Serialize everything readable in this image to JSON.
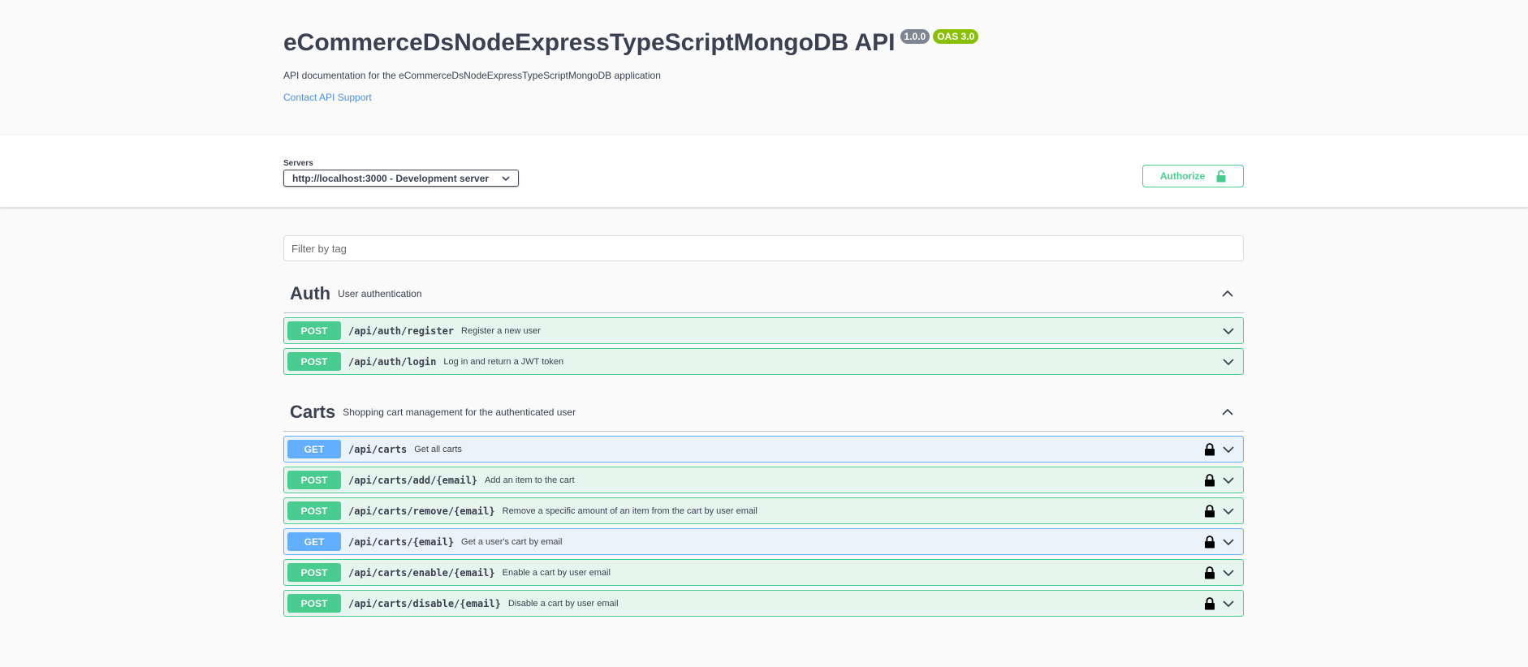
{
  "info": {
    "title": "eCommerceDsNodeExpressTypeScriptMongoDB API",
    "version": "1.0.0",
    "oas": "OAS 3.0",
    "description": "API documentation for the eCommerceDsNodeExpressTypeScriptMongoDB application",
    "contact": "Contact API Support"
  },
  "servers": {
    "label": "Servers",
    "selected": "http://localhost:3000 - Development server"
  },
  "authorize": {
    "label": "Authorize"
  },
  "filter": {
    "placeholder": "Filter by tag"
  },
  "tags": [
    {
      "name": "Auth",
      "description": "User authentication",
      "operations": [
        {
          "method": "POST",
          "path": "/api/auth/register",
          "summary": "Register a new user",
          "locked": false
        },
        {
          "method": "POST",
          "path": "/api/auth/login",
          "summary": "Log in and return a JWT token",
          "locked": false
        }
      ]
    },
    {
      "name": "Carts",
      "description": "Shopping cart management for the authenticated user",
      "operations": [
        {
          "method": "GET",
          "path": "/api/carts",
          "summary": "Get all carts",
          "locked": true
        },
        {
          "method": "POST",
          "path": "/api/carts/add/{email}",
          "summary": "Add an item to the cart",
          "locked": true
        },
        {
          "method": "POST",
          "path": "/api/carts/remove/{email}",
          "summary": "Remove a specific amount of an item from the cart by user email",
          "locked": true
        },
        {
          "method": "GET",
          "path": "/api/carts/{email}",
          "summary": "Get a user's cart by email",
          "locked": true
        },
        {
          "method": "POST",
          "path": "/api/carts/enable/{email}",
          "summary": "Enable a cart by user email",
          "locked": true
        },
        {
          "method": "POST",
          "path": "/api/carts/disable/{email}",
          "summary": "Disable a cart by user email",
          "locked": true
        }
      ]
    }
  ],
  "colors": {
    "post": "#49cc90",
    "get": "#61affe",
    "text": "#3b4151",
    "link": "#4990e2"
  }
}
